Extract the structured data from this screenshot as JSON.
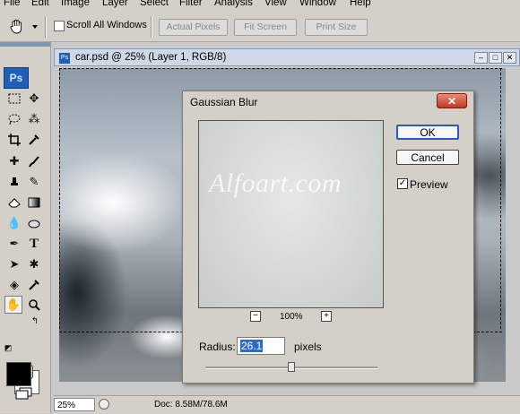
{
  "menu": [
    "File",
    "Edit",
    "Image",
    "Layer",
    "Select",
    "Filter",
    "Analysis",
    "View",
    "Window",
    "Help"
  ],
  "options": {
    "scroll_all_windows": "Scroll All Windows",
    "actual_pixels": "Actual Pixels",
    "fit_screen": "Fit Screen",
    "print_size": "Print Size"
  },
  "tools": {
    "logo": "Ps"
  },
  "document": {
    "title": "car.psd @ 25% (Layer 1, RGB/8)",
    "zoom": "25%",
    "info": "Doc: 8.58M/78.6M"
  },
  "dialog": {
    "title": "Gaussian Blur",
    "ok": "OK",
    "cancel": "Cancel",
    "preview_label": "Preview",
    "preview_checked": true,
    "zoom_level": "100%",
    "radius_label": "Radius:",
    "radius_value": "26.1",
    "radius_unit": "pixels",
    "radius_slider_fraction": 0.5
  },
  "watermark": "Alfoart.com"
}
